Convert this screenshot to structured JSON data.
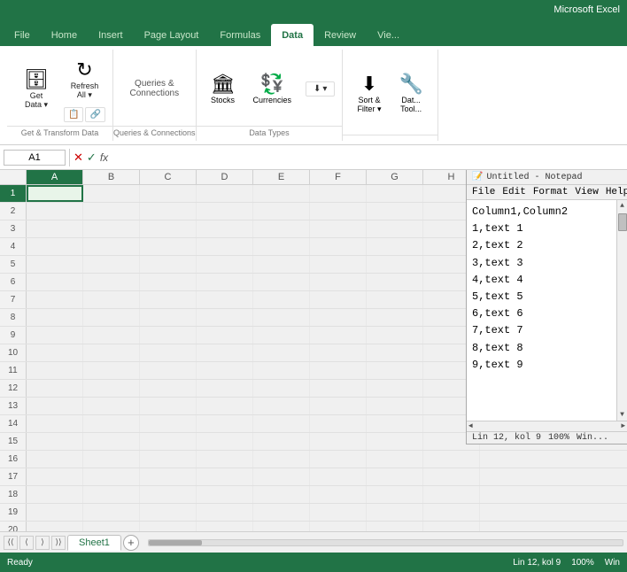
{
  "titlebar": {
    "title": "Microsoft Excel"
  },
  "tabs": [
    {
      "label": "File",
      "active": false
    },
    {
      "label": "Home",
      "active": false
    },
    {
      "label": "Insert",
      "active": false
    },
    {
      "label": "Page Layout",
      "active": false
    },
    {
      "label": "Formulas",
      "active": false
    },
    {
      "label": "Data",
      "active": true
    },
    {
      "label": "Review",
      "active": false
    },
    {
      "label": "View",
      "active": false
    }
  ],
  "ribbon": {
    "groups": [
      {
        "name": "get-transform",
        "label": "Get & Transform Data",
        "buttons": [
          {
            "id": "get-data",
            "icon": "🗄",
            "label": "Get\nData",
            "hasArrow": true
          },
          {
            "id": "refresh-all",
            "icon": "↻",
            "label": "Refresh\nAll",
            "hasArrow": true
          }
        ],
        "smallButtons": [
          {
            "id": "from-text",
            "icon": "📄",
            "label": ""
          },
          {
            "id": "from-web",
            "icon": "🌐",
            "label": ""
          }
        ]
      },
      {
        "name": "queries-connections",
        "label": "Queries & Connections",
        "buttons": []
      },
      {
        "name": "data-types",
        "label": "Data Types",
        "buttons": [
          {
            "id": "stocks",
            "icon": "📈",
            "label": "Stocks"
          },
          {
            "id": "currencies",
            "icon": "💱",
            "label": "Currencies"
          }
        ]
      },
      {
        "name": "sort-filter",
        "label": "",
        "buttons": [
          {
            "id": "sort-filter",
            "icon": "⬇",
            "label": "Sort &\nFilter"
          },
          {
            "id": "data-tools",
            "icon": "🔧",
            "label": "Dat...\nTool..."
          }
        ]
      }
    ]
  },
  "formulaBar": {
    "nameBox": "A1",
    "formula": ""
  },
  "columns": [
    "A",
    "B",
    "C",
    "D",
    "E",
    "F",
    "G",
    "H"
  ],
  "rows": 20,
  "selectedCell": "A1",
  "sheetTabs": [
    {
      "label": "Sheet1",
      "active": true
    }
  ],
  "statusBar": {
    "position": "Lin 12, kol 9",
    "zoom": "100%",
    "windowMode": "Win"
  },
  "notepad": {
    "title": "Untitled - Notepad",
    "scrollbarVisible": true,
    "content": "Column1,Column2\n1,text 1\n2,text 2\n3,text 3\n4,text 4\n5,text 5\n6,text 6\n7,text 7\n8,text 8\n9,text 9",
    "statusPosition": "Lin 12, kol 9",
    "statusEncoding": "Win..."
  }
}
